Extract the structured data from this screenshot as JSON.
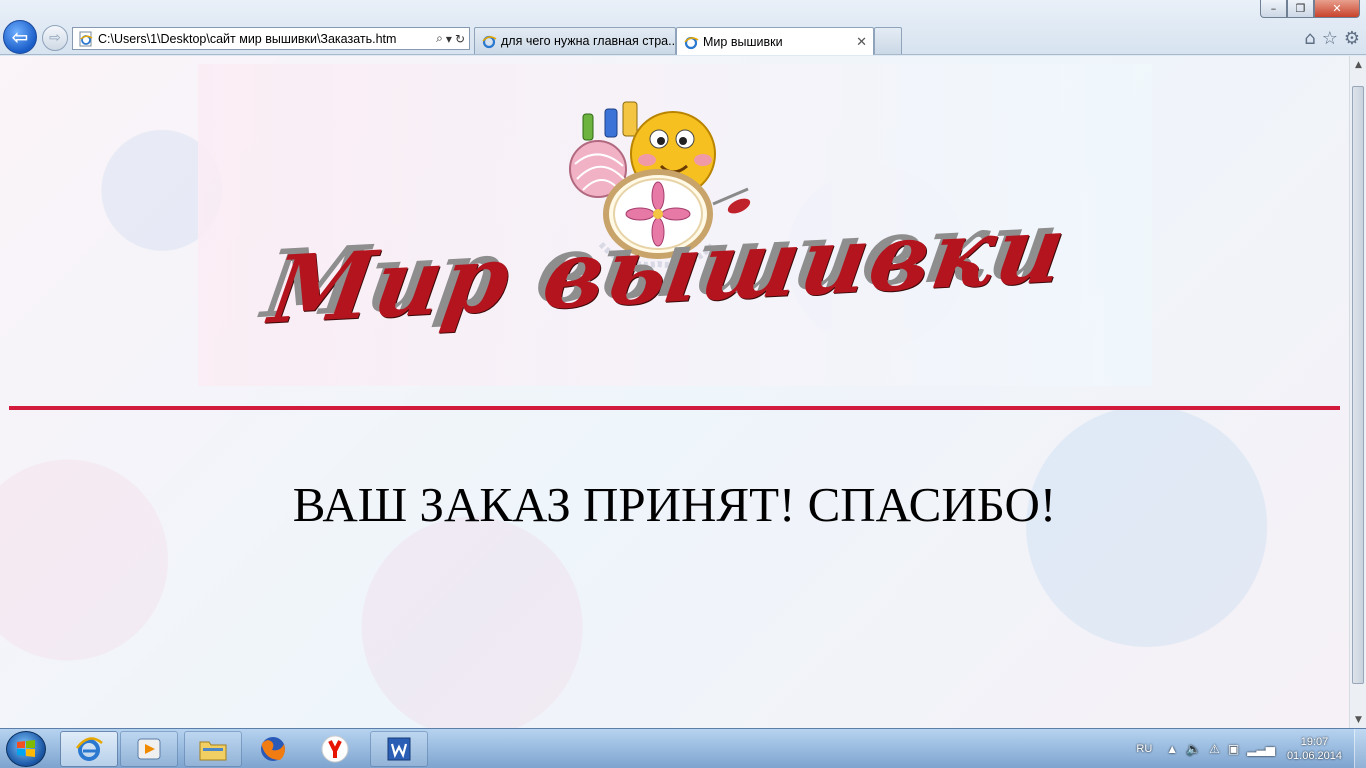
{
  "window": {
    "minimize_label": "–",
    "maximize_label": "❐",
    "close_label": "✕"
  },
  "navigation": {
    "back_icon": "back-arrow-icon",
    "forward_icon": "forward-arrow-icon"
  },
  "address_bar": {
    "url": "C:\\Users\\1\\Desktop\\сайт мир вышивки\\Заказать.htm"
  },
  "tabs": [
    {
      "title": "для чего нужна главная стра...",
      "active": false
    },
    {
      "title": "Мир вышивки",
      "active": true,
      "close_label": "✕"
    }
  ],
  "toolbar_icons": [
    "home-icon",
    "favorites-star-icon",
    "gear-icon"
  ],
  "page": {
    "logo_text": "Мир вышивки",
    "message": "ВАШ ЗАКАЗ ПРИНЯТ! СПАСИБО!",
    "divider_color": "#d21a3c",
    "logo_text_color": "#b4141e"
  },
  "taskbar": {
    "items": [
      {
        "name": "internet-explorer",
        "active": true
      },
      {
        "name": "media-player",
        "active": false
      },
      {
        "name": "file-explorer",
        "active": false
      },
      {
        "name": "firefox",
        "active": false
      },
      {
        "name": "yandex-browser",
        "active": false
      },
      {
        "name": "microsoft-word",
        "active": false
      }
    ],
    "tray": {
      "language": "RU",
      "time": "19:07",
      "date": "01.06.2014"
    }
  }
}
